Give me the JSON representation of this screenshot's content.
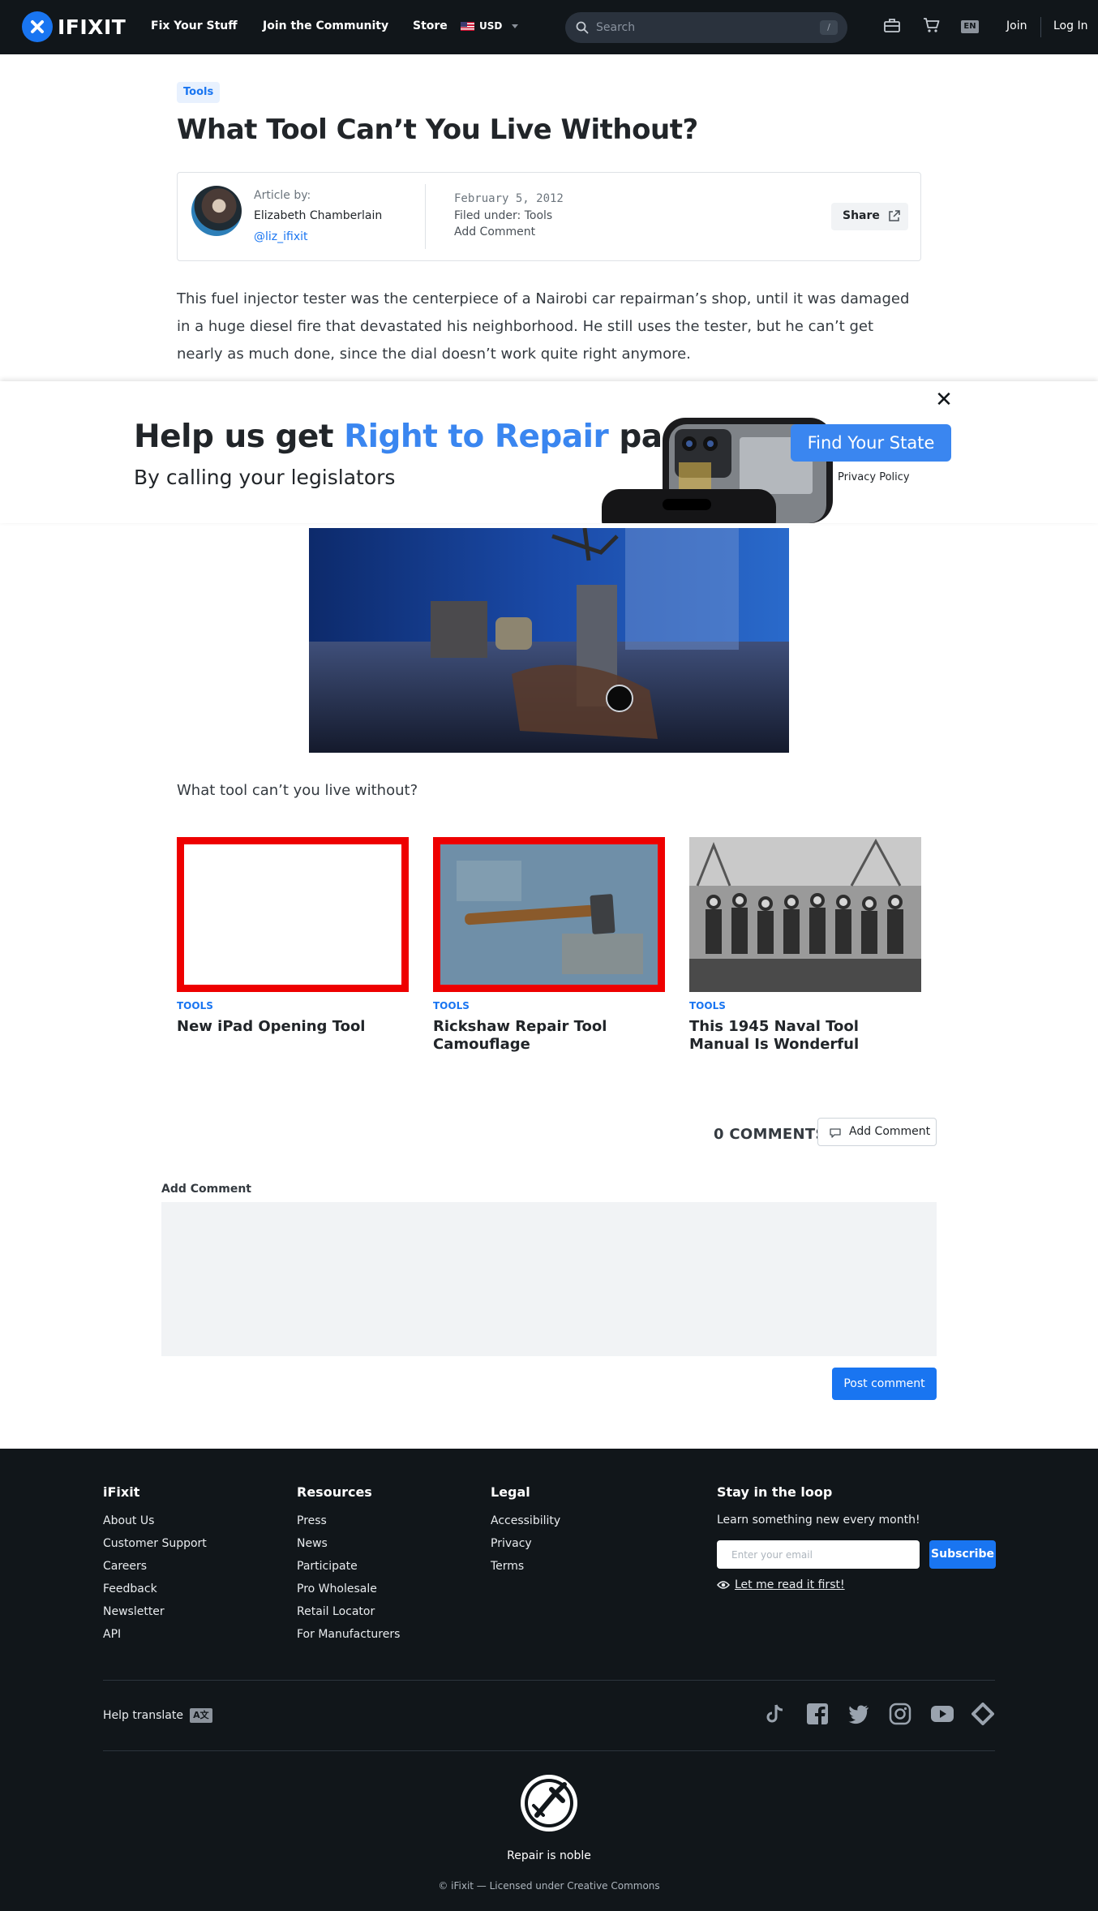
{
  "header": {
    "logo_text": "IFIXIT",
    "nav": [
      "Fix Your Stuff",
      "Join the Community",
      "Store"
    ],
    "currency": "USD",
    "search_placeholder": "Search",
    "search_shortcut": "/",
    "lang": "EN",
    "join": "Join",
    "login": "Log In"
  },
  "article": {
    "tag": "Tools",
    "title": "What Tool Can’t You Live Without?",
    "byline": {
      "label": "Article by:",
      "author": "Elizabeth Chamberlain",
      "handle": "@liz_ifixit",
      "date": "February 5, 2012",
      "filed_label": "Filed under:",
      "filed_value": "Tools",
      "add_comment": "Add Comment",
      "share": "Share"
    },
    "body": "This fuel injector tester was the centerpiece of a Nairobi car repairman’s shop, until it was damaged in a huge diesel fire that devastated his neighborhood. He still uses the tester, but he can’t get nearly as much done, since the dial doesn’t work quite right anymore.",
    "question": "What tool can’t you live without?"
  },
  "banner": {
    "close": "✕",
    "headline_start": "Help us get ",
    "headline_highlight": "Right to Repair",
    "headline_end": " passed",
    "subhead": "By calling your legislators",
    "cta": "Find Your State",
    "privacy": "Privacy Policy"
  },
  "related": [
    {
      "tag": "TOOLS",
      "title": "New iPad Opening Tool"
    },
    {
      "tag": "TOOLS",
      "title": "Rickshaw Repair Tool Camouflage"
    },
    {
      "tag": "TOOLS",
      "title": "This 1945 Naval Tool Manual Is Wonderful"
    }
  ],
  "comments": {
    "count": "0 COMMENTS",
    "add_button": "Add Comment",
    "form_label": "Add Comment",
    "post": "Post comment"
  },
  "footer": {
    "cols": [
      {
        "heading": "iFixit",
        "links": [
          "About Us",
          "Customer Support",
          "Careers",
          "Feedback",
          "Newsletter",
          "API"
        ]
      },
      {
        "heading": "Resources",
        "links": [
          "Press",
          "News",
          "Participate",
          "Pro Wholesale",
          "Retail Locator",
          "For Manufacturers"
        ]
      },
      {
        "heading": "Legal",
        "links": [
          "Accessibility",
          "Privacy",
          "Terms"
        ]
      }
    ],
    "loop_heading": "Stay in the loop",
    "loop_sub": "Learn something new every month!",
    "email_placeholder": "Enter your email",
    "subscribe": "Subscribe",
    "read_first": "Let me read it first!",
    "help_translate": "Help translate",
    "social": [
      "tiktok-icon",
      "facebook-icon",
      "twitter-icon",
      "instagram-icon",
      "youtube-icon",
      "hashnode-icon"
    ],
    "tagline": "Repair is noble",
    "copyright": "© iFixit — Licensed under Creative Commons"
  },
  "colors": {
    "brand_blue": "#1975f1",
    "banner_blue": "#3a86f0",
    "dark": "#11161a",
    "card_border_red": "#ee0000"
  }
}
